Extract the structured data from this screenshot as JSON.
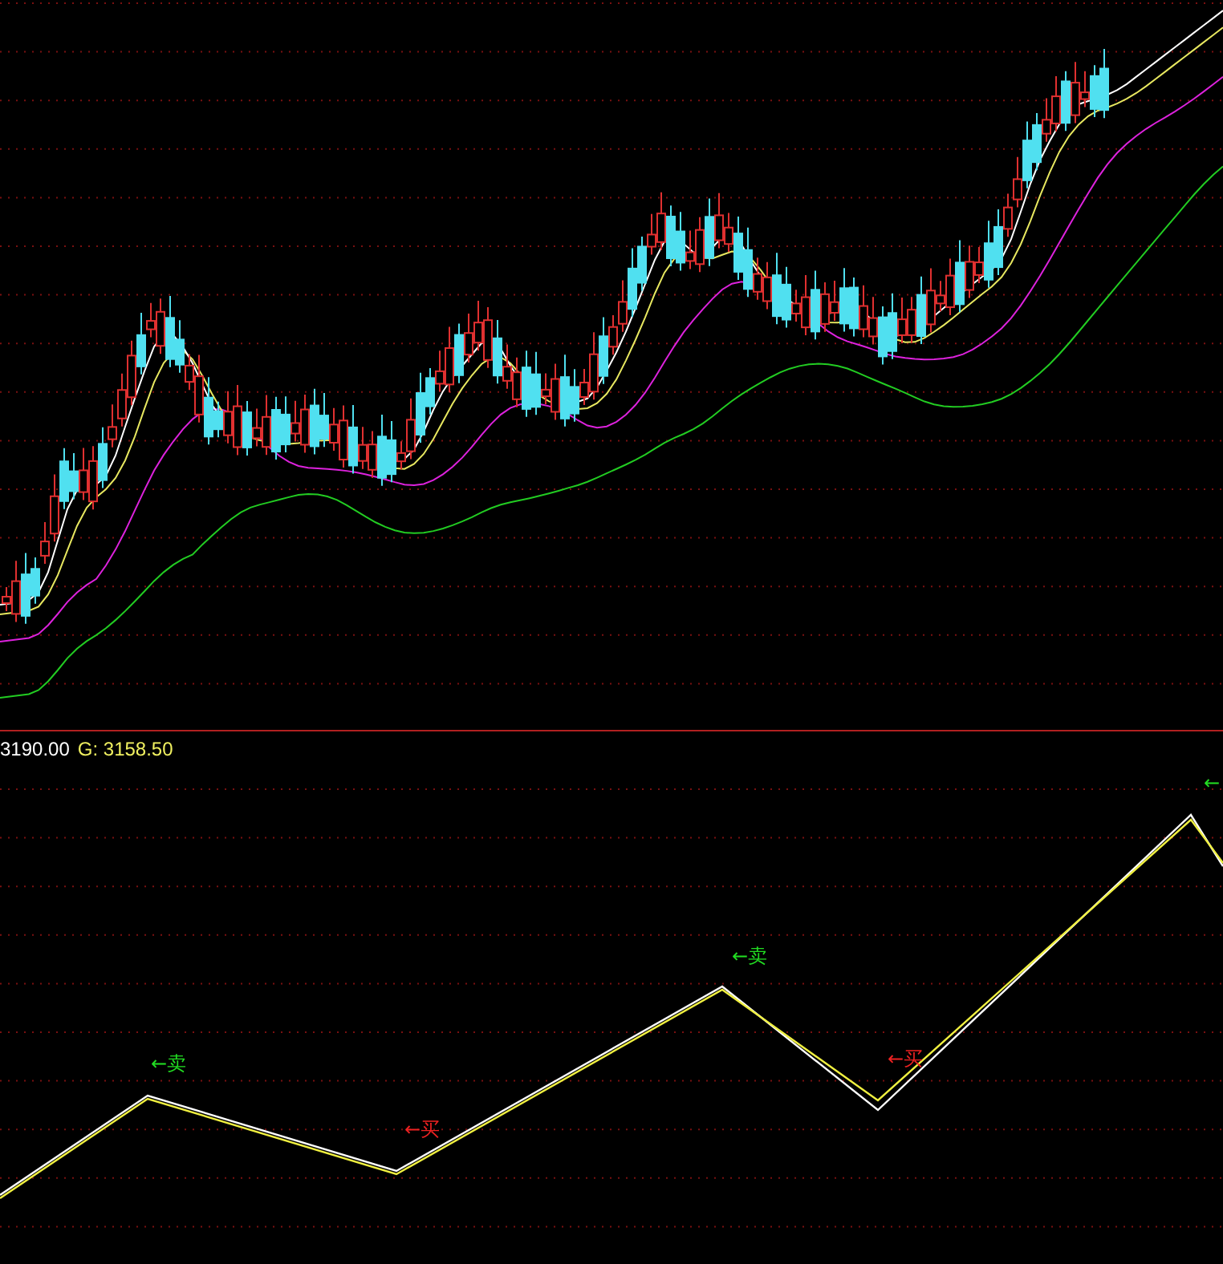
{
  "indicator": {
    "value": "3190.00",
    "g_reading": "G: 3158.50"
  },
  "signals": [
    {
      "kind": "sell",
      "text": "←卖"
    },
    {
      "kind": "buy",
      "text": "←买"
    },
    {
      "kind": "sell",
      "text": "←卖"
    },
    {
      "kind": "buy",
      "text": "←买"
    },
    {
      "kind": "sell",
      "text": "←"
    }
  ]
}
